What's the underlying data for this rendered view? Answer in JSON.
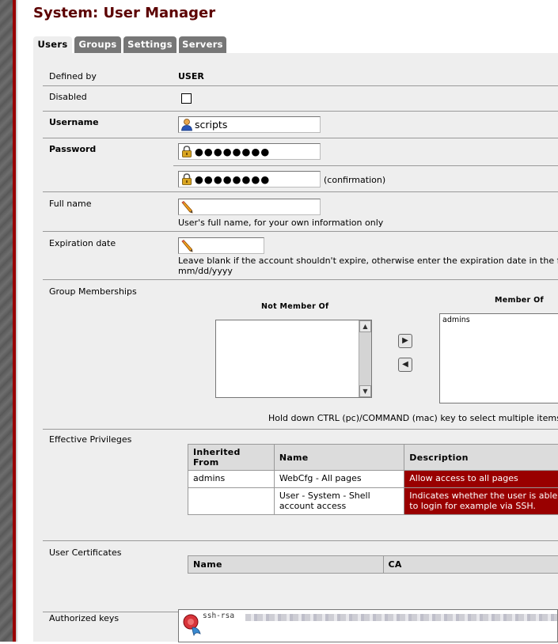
{
  "page": {
    "title": "System: User Manager"
  },
  "tabs": [
    {
      "label": "Users",
      "active": true
    },
    {
      "label": "Groups",
      "active": false
    },
    {
      "label": "Settings",
      "active": false
    },
    {
      "label": "Servers",
      "active": false
    }
  ],
  "form": {
    "defined_by": {
      "label": "Defined by",
      "value": "USER"
    },
    "disabled": {
      "label": "Disabled",
      "checked": false
    },
    "username": {
      "label": "Username",
      "value": "scripts",
      "icon": "user-icon"
    },
    "password": {
      "label": "Password",
      "value": "●●●●●●●●",
      "confirm_value": "●●●●●●●●",
      "confirm_note": "(confirmation)",
      "icon": "lock-icon"
    },
    "fullname": {
      "label": "Full name",
      "value": "",
      "hint": "User's full name, for your own information only",
      "icon": "pencil-icon"
    },
    "expiration": {
      "label": "Expiration date",
      "value": "",
      "hint_line1": "Leave blank if the account shouldn't expire, otherwise enter the expiration date in the followi",
      "hint_line2": "mm/dd/yyyy",
      "icon": "pencil-icon"
    },
    "groups": {
      "label": "Group Memberships",
      "not_member_heading": "Not Member Of",
      "member_heading": "Member Of",
      "not_member_items": [],
      "member_items": [
        "admins"
      ],
      "hint": "Hold down CTRL (pc)/COMMAND (mac) key to select multiple items"
    },
    "privileges": {
      "label": "Effective Privileges",
      "columns": [
        "Inherited From",
        "Name",
        "Description"
      ],
      "rows": [
        {
          "inherited": "admins",
          "name": "WebCfg - All pages",
          "description": "Allow access to all pages"
        },
        {
          "inherited": "",
          "name": "User - System - Shell account access",
          "description": "Indicates whether the user is able to login for example via SSH."
        }
      ]
    },
    "certificates": {
      "label": "User Certificates",
      "columns": [
        "Name",
        "CA"
      ]
    },
    "authorized_keys": {
      "label": "Authorized keys",
      "value": "ssh-rsa"
    }
  },
  "colors": {
    "accent": "#990000",
    "title": "#5c0000",
    "panel": "#eeeeee",
    "tab": "#777777"
  }
}
